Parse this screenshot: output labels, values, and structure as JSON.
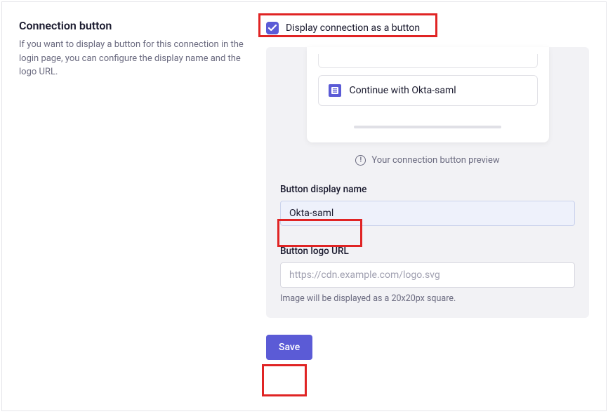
{
  "section": {
    "title": "Connection button",
    "description": "If you want to display a button for this connection in the login page, you can configure the display name and the logo URL."
  },
  "checkbox": {
    "label": "Display connection as a button",
    "checked": true
  },
  "preview": {
    "button_prefix": "Continue with",
    "button_name": "Okta-saml",
    "caption": "Your connection button preview"
  },
  "fields": {
    "display_name": {
      "label": "Button display name",
      "value": "Okta-saml"
    },
    "logo_url": {
      "label": "Button logo URL",
      "value": "",
      "placeholder": "https://cdn.example.com/logo.svg",
      "helper": "Image will be displayed as a 20x20px square."
    }
  },
  "actions": {
    "save_label": "Save"
  }
}
